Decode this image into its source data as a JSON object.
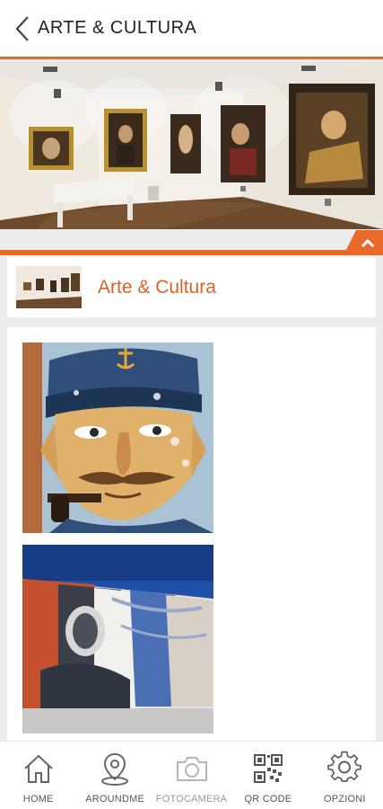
{
  "header": {
    "title": "ARTE & CULTURA"
  },
  "card": {
    "title": "Arte & Cultura"
  },
  "nav": {
    "items": [
      {
        "label": "HOME",
        "icon": "home-icon"
      },
      {
        "label": "AROUNDME",
        "icon": "location-pin-icon"
      },
      {
        "label": "FOTOCAMERA",
        "icon": "camera-icon"
      },
      {
        "label": "QR CODE",
        "icon": "qr-code-icon"
      },
      {
        "label": "OPZIONI",
        "icon": "gear-icon"
      }
    ]
  },
  "colors": {
    "accent": "#e8692a",
    "title": "#d9642a",
    "background": "#ececec"
  }
}
